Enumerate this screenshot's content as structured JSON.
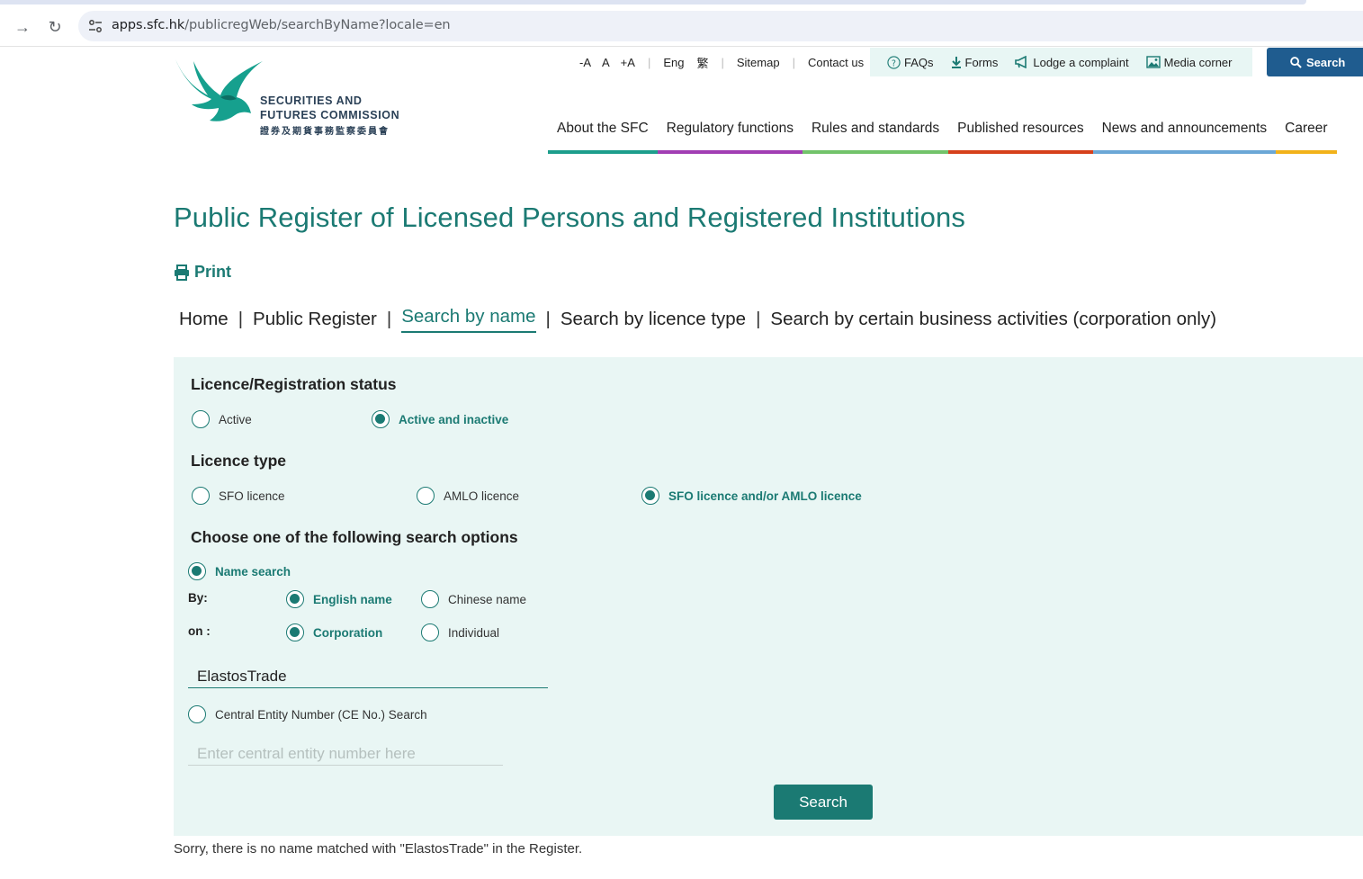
{
  "browser": {
    "url_host": "apps.sfc.hk",
    "url_path": "/publicregWeb/searchByName?locale=en"
  },
  "header": {
    "logo_line1": "SECURITIES AND",
    "logo_line2": "FUTURES COMMISSION",
    "logo_cjk": "證券及期貨事務監察委員會",
    "font_controls": [
      "-A",
      "A",
      "+A"
    ],
    "lang_eng": "Eng",
    "lang_tc": "繁",
    "sitemap": "Sitemap",
    "contact": "Contact us",
    "quick_links": [
      "FAQs",
      "Forms",
      "Lodge a complaint",
      "Media corner"
    ],
    "search_label": "Search"
  },
  "main_nav": [
    {
      "label": "About the SFC",
      "color": "#1d9e8c"
    },
    {
      "label": "Regulatory functions",
      "color": "#a13eb3"
    },
    {
      "label": "Rules and standards",
      "color": "#72c36a"
    },
    {
      "label": "Published resources",
      "color": "#d6401b"
    },
    {
      "label": "News and announcements",
      "color": "#6ba7d6"
    },
    {
      "label": "Career",
      "color": "#f2b21a"
    }
  ],
  "page": {
    "title": "Public Register of Licensed Persons and Registered Institutions",
    "print": "Print"
  },
  "breadcrumb": {
    "home": "Home",
    "public_register": "Public Register",
    "search_by_name": "Search by name",
    "search_by_licence": "Search by licence type",
    "search_by_activity": "Search by certain business activities (corporation only)"
  },
  "form": {
    "status_heading": "Licence/Registration status",
    "status_options": [
      "Active",
      "Active and inactive"
    ],
    "status_selected": "Active and inactive",
    "licence_heading": "Licence type",
    "licence_options": [
      "SFO licence",
      "AMLO licence",
      "SFO licence and/or AMLO licence"
    ],
    "licence_selected": "SFO licence and/or AMLO licence",
    "search_heading": "Choose one of the following search options",
    "name_search_label": "Name search",
    "by_label": "By:",
    "by_options": [
      "English name",
      "Chinese name"
    ],
    "on_label": "on :",
    "on_options": [
      "Corporation",
      "Individual"
    ],
    "name_value": "ElastosTrade",
    "ce_search_label": "Central Entity Number (CE No.) Search",
    "ce_placeholder": "Enter central entity number here",
    "search_button": "Search"
  },
  "result_message": "Sorry, there is no name matched with \"ElastosTrade\" in the Register.",
  "colors": {
    "brand_teal": "#1b7a73",
    "panel_bg": "#e9f6f4",
    "top_search_bg": "#1f5c8f"
  }
}
